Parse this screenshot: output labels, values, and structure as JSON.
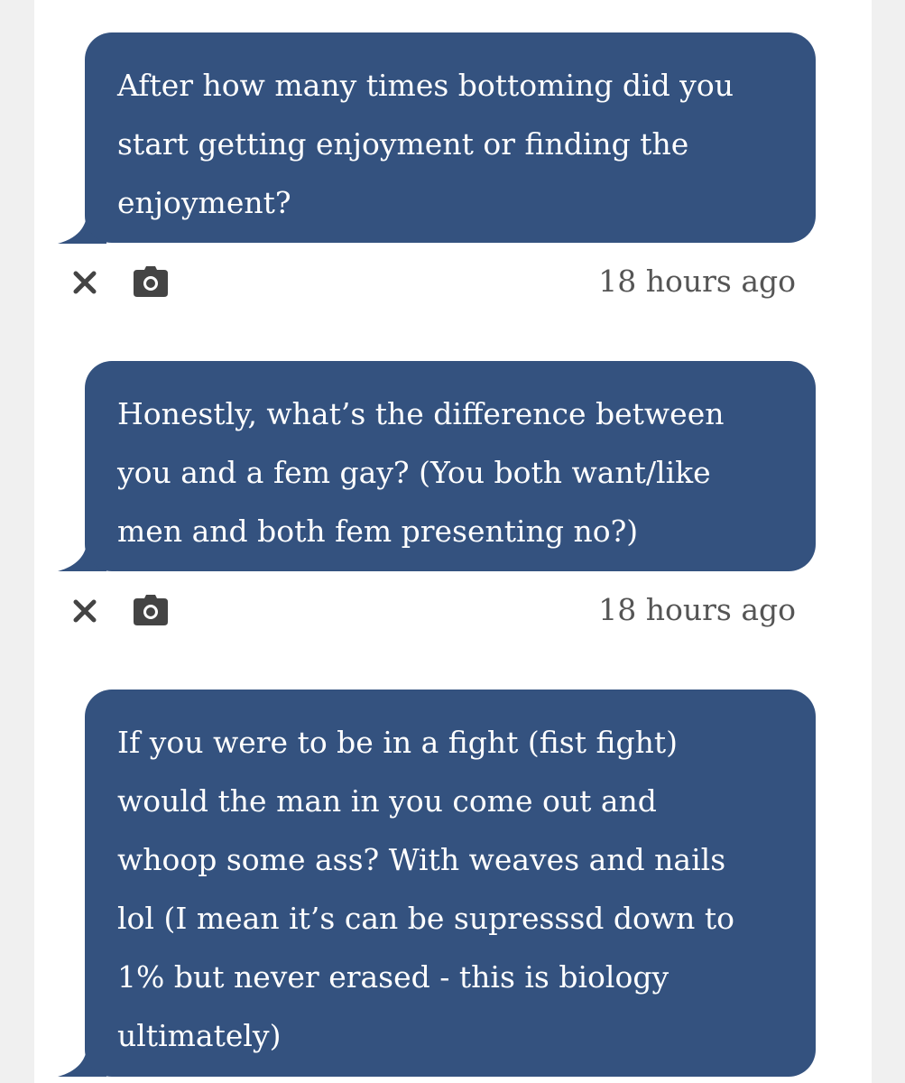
{
  "messages": [
    {
      "text": "After how many times bottoming did you\nstart getting enjoyment or finding the\nenjoyment?",
      "timestamp": "18 hours ago"
    },
    {
      "text": "Honestly, what’s the difference between\nyou and a fem gay? (You both want/like\nmen and both fem presenting no?)",
      "timestamp": "18 hours ago"
    },
    {
      "text": "If you were to be in a fight (fist fight)\nwould the man in you come out and\nwhoop some ass? With weaves and nails\nlol (I mean it’s can be supresssd down to\n1% but never erased - this is biology\nultimately)"
    }
  ],
  "colors": {
    "bubble": "#34527f",
    "bubble_text": "#ffffff",
    "page_background": "#ffffff",
    "outer_background": "#f0f0f0",
    "icon": "#444444",
    "timestamp": "#555555"
  },
  "icons": {
    "dismiss": "close-icon",
    "screenshot": "camera-icon"
  }
}
